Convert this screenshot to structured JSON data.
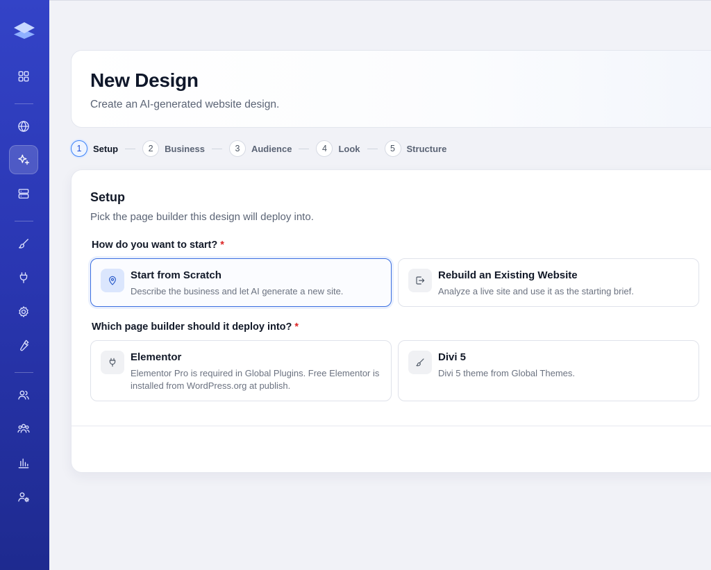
{
  "app": {
    "logo_icon": "layers-logo-icon"
  },
  "sidebar": {
    "items": [
      {
        "icon": "grid-icon"
      },
      {
        "icon": "globe-icon"
      },
      {
        "icon": "sparkles-icon",
        "active": true
      },
      {
        "icon": "server-icon"
      },
      {
        "icon": "brush-icon"
      },
      {
        "icon": "plug-icon"
      },
      {
        "icon": "gear-icon"
      },
      {
        "icon": "wrench-icon"
      },
      {
        "icon": "users-icon"
      },
      {
        "icon": "team-icon"
      },
      {
        "icon": "bar-chart-icon"
      },
      {
        "icon": "user-settings-icon"
      }
    ]
  },
  "header": {
    "title": "New Design",
    "subtitle": "Create an AI-generated website design."
  },
  "stepper": {
    "steps": [
      {
        "num": "1",
        "label": "Setup",
        "active": true
      },
      {
        "num": "2",
        "label": "Business"
      },
      {
        "num": "3",
        "label": "Audience"
      },
      {
        "num": "4",
        "label": "Look"
      },
      {
        "num": "5",
        "label": "Structure"
      }
    ]
  },
  "setup": {
    "title": "Setup",
    "subtitle": "Pick the page builder this design will deploy into.",
    "start_question": "How do you want to start?",
    "start_options": [
      {
        "title": "Start from Scratch",
        "description": "Describe the business and let AI generate a new site.",
        "icon": "map-pin-icon",
        "selected": true
      },
      {
        "title": "Rebuild an Existing Website",
        "description": "Analyze a live site and use it as the starting brief.",
        "icon": "import-icon"
      }
    ],
    "builder_question": "Which page builder should it deploy into?",
    "builder_options": [
      {
        "title": "Elementor",
        "description": "Elementor Pro is required in Global Plugins. Free Elementor is installed from WordPress.org at publish.",
        "icon": "plug-icon"
      },
      {
        "title": "Divi 5",
        "description": "Divi 5 theme from Global Themes.",
        "icon": "brush-icon"
      }
    ],
    "required_marker": "*"
  },
  "colors": {
    "sidebar": "#2a37b3",
    "accent": "#3b6fe0",
    "required": "#dc2626"
  }
}
